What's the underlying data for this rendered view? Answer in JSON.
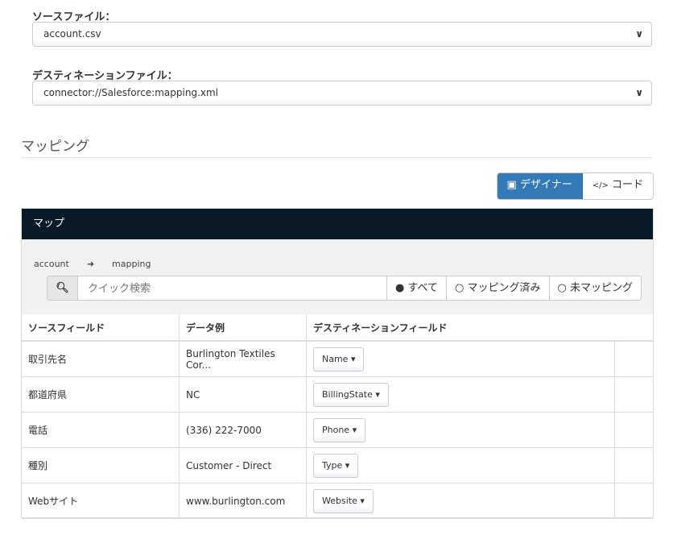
{
  "source": {
    "label": "ソースファイル：",
    "value": "account.csv"
  },
  "destination": {
    "label": "デスティネーションファイル：",
    "value": "connector://Salesforce:mapping.xml"
  },
  "section_title": "マッピング",
  "view_toggle": {
    "designer": "デザイナー",
    "code": "コード"
  },
  "panel": {
    "title": "マップ",
    "breadcrumb_from": "account",
    "breadcrumb_to": "mapping",
    "search_placeholder": "クイック検索",
    "filters": [
      "すべて",
      "マッピング済み",
      "未マッピング"
    ],
    "columns": [
      "ソースフィールド",
      "データ例",
      "デスティネーションフィールド"
    ],
    "rows": [
      {
        "source": "取引先名",
        "sample": "Burlington Textiles Cor...",
        "dest": "Name"
      },
      {
        "source": "都道府県",
        "sample": "NC",
        "dest": "BillingState"
      },
      {
        "source": "電話",
        "sample": "(336) 222-7000",
        "dest": "Phone"
      },
      {
        "source": "種別",
        "sample": "Customer - Direct",
        "dest": "Type"
      },
      {
        "source": "Webサイト",
        "sample": "www.burlington.com",
        "dest": "Website"
      }
    ]
  }
}
